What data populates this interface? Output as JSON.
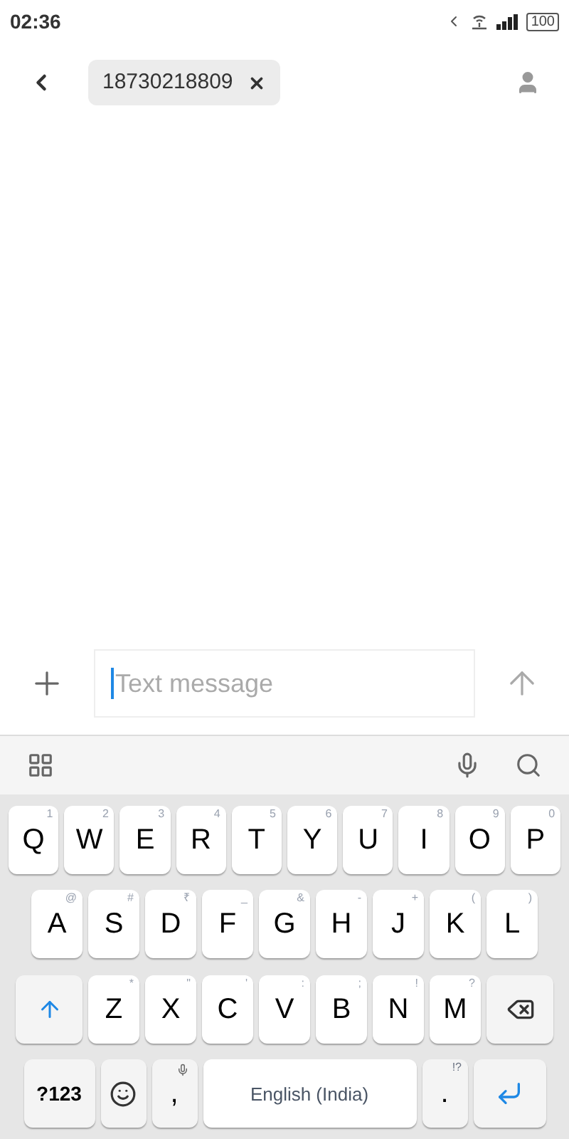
{
  "status_bar": {
    "time": "02:36",
    "battery": "100"
  },
  "header": {
    "recipient": "18730218809"
  },
  "composer": {
    "placeholder": "Text message"
  },
  "keyboard": {
    "rows": [
      {
        "keys": [
          {
            "kind": "letter",
            "label": "Q",
            "hint": "1"
          },
          {
            "kind": "letter",
            "label": "W",
            "hint": "2"
          },
          {
            "kind": "letter",
            "label": "E",
            "hint": "3"
          },
          {
            "kind": "letter",
            "label": "R",
            "hint": "4"
          },
          {
            "kind": "letter",
            "label": "T",
            "hint": "5"
          },
          {
            "kind": "letter",
            "label": "Y",
            "hint": "6"
          },
          {
            "kind": "letter",
            "label": "U",
            "hint": "7"
          },
          {
            "kind": "letter",
            "label": "I",
            "hint": "8"
          },
          {
            "kind": "letter",
            "label": "O",
            "hint": "9"
          },
          {
            "kind": "letter",
            "label": "P",
            "hint": "0"
          }
        ]
      },
      {
        "keys": [
          {
            "kind": "letter",
            "label": "A",
            "hint": "@"
          },
          {
            "kind": "letter",
            "label": "S",
            "hint": "#"
          },
          {
            "kind": "letter",
            "label": "D",
            "hint": "₹"
          },
          {
            "kind": "letter",
            "label": "F",
            "hint": "_"
          },
          {
            "kind": "letter",
            "label": "G",
            "hint": "&"
          },
          {
            "kind": "letter",
            "label": "H",
            "hint": "-"
          },
          {
            "kind": "letter",
            "label": "J",
            "hint": "+"
          },
          {
            "kind": "letter",
            "label": "K",
            "hint": "("
          },
          {
            "kind": "letter",
            "label": "L",
            "hint": ")"
          }
        ]
      },
      {
        "keys": [
          {
            "kind": "shift"
          },
          {
            "kind": "letter",
            "label": "Z",
            "hint": "*"
          },
          {
            "kind": "letter",
            "label": "X",
            "hint": "\""
          },
          {
            "kind": "letter",
            "label": "C",
            "hint": "'"
          },
          {
            "kind": "letter",
            "label": "V",
            "hint": ":"
          },
          {
            "kind": "letter",
            "label": "B",
            "hint": ";"
          },
          {
            "kind": "letter",
            "label": "N",
            "hint": "!"
          },
          {
            "kind": "letter",
            "label": "M",
            "hint": "?"
          },
          {
            "kind": "backspace"
          }
        ]
      },
      {
        "keys": [
          {
            "kind": "symbols",
            "label": "?123"
          },
          {
            "kind": "emoji"
          },
          {
            "kind": "comma",
            "label": ","
          },
          {
            "kind": "space",
            "label": "English (India)"
          },
          {
            "kind": "period",
            "label": ".",
            "hint": "!?"
          },
          {
            "kind": "enter"
          }
        ]
      }
    ]
  }
}
